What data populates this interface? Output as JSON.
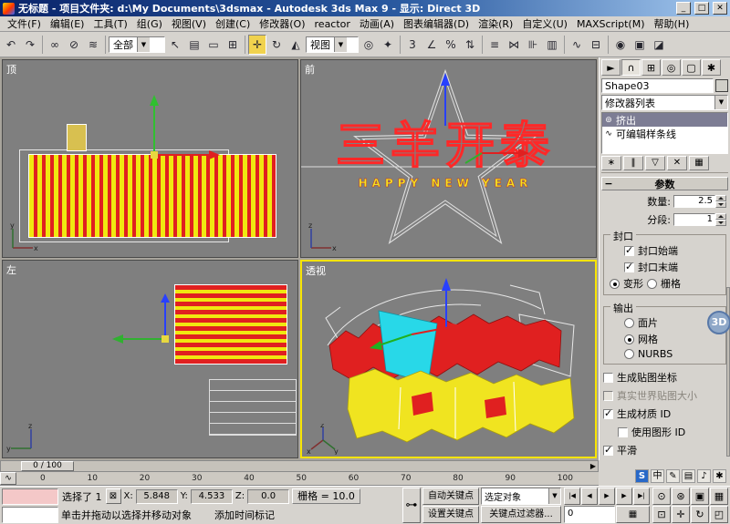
{
  "titlebar": {
    "title": "无标题 - 项目文件夹: d:\\My Documents\\3dsmax  -  Autodesk 3ds Max 9  -  显示: Direct 3D"
  },
  "menu": {
    "items": [
      "文件(F)",
      "编辑(E)",
      "工具(T)",
      "组(G)",
      "视图(V)",
      "创建(C)",
      "修改器(O)",
      "reactor",
      "动画(A)",
      "图表编辑器(D)",
      "渲染(R)",
      "自定义(U)",
      "MAXScript(M)",
      "帮助(H)"
    ]
  },
  "toolbar": {
    "selection_filter": "全部",
    "coord_system": "视图"
  },
  "viewports": {
    "top": {
      "label": "顶"
    },
    "front": {
      "label": "前",
      "banner": "三羊开泰",
      "subbanner": "HAPPY NEW YEAR"
    },
    "left": {
      "label": "左"
    },
    "persp": {
      "label": "透视"
    }
  },
  "panel": {
    "object_name": "Shape03",
    "modifier_list": "修改器列表",
    "stack": [
      {
        "label": "挤出"
      },
      {
        "label": "可编辑样条线"
      }
    ],
    "rollout_title": "参数",
    "amount_label": "数量:",
    "amount_value": "2.5",
    "segments_label": "分段:",
    "segments_value": "1",
    "cap_group": "封口",
    "cap_start": "封口始端",
    "cap_end": "封口末端",
    "morph": "变形",
    "grid": "栅格",
    "output_group": "输出",
    "patch": "面片",
    "mesh": "网格",
    "nurbs": "NURBS",
    "gen_mapping": "生成贴图坐标",
    "real_world": "真实世界贴图大小",
    "gen_matid": "生成材质 ID",
    "use_shapeid": "使用图形 ID",
    "smooth": "平滑",
    "badge_3d": "3D"
  },
  "time": {
    "slider_label": "0 / 100",
    "ticks": [
      "0",
      "10",
      "20",
      "30",
      "40",
      "50",
      "60",
      "70",
      "80",
      "90",
      "100"
    ]
  },
  "status": {
    "selection_count": "选择了 1",
    "x_label": "X:",
    "x_value": "5.848",
    "y_label": "Y:",
    "y_value": "4.533",
    "z_label": "Z:",
    "z_value": "0.0",
    "grid_readout": "栅格 = 10.0",
    "prompt": "单击并拖动以选择并移动对象",
    "add_time_tag": "添加时间标记",
    "auto_key": "自动关键点",
    "set_key": "设置关键点",
    "selected_objects": "选定对象",
    "key_filters": "关键点过滤器...",
    "frame_value": "0"
  },
  "icons": {
    "min": "_",
    "max": "□",
    "close": "✕",
    "undo": "↶",
    "redo": "↷",
    "select_link": "∞",
    "unlink": "⊘",
    "bind_spacewarp": "≋",
    "select_object": "↖",
    "select_by_name": "▤",
    "rect_region": "▭",
    "crossing": "⊞",
    "move": "✛",
    "rotate": "↻",
    "scale": "◭",
    "pivot": "◎",
    "manipulate": "✦",
    "snap_3d": "3",
    "snap_angle": "∠",
    "snap_percent": "%",
    "snap_spinner": "⇅",
    "named_sets": "≡",
    "mirror": "⋈",
    "align": "⊪",
    "layers": "▥",
    "curve_editor": "∿",
    "schematic": "⊟",
    "material": "◉",
    "render_setup": "▣",
    "quick_render": "◪",
    "tab_create": "►",
    "tab_modify": "∩",
    "tab_hierarchy": "⊞",
    "tab_motion": "◎",
    "tab_display": "▢",
    "tab_utilities": "✱",
    "stack_mod": "⊚",
    "stack_base": "∿",
    "pin": "∗",
    "show_end": "‖",
    "unique": "▽",
    "remove": "✕",
    "config": "▦",
    "lock": "⊠",
    "key": "⊶",
    "dropdown": "▼",
    "minus": "−",
    "play_start": "|◀",
    "play_prev": "◀",
    "play": "▶",
    "play_next": "▶",
    "play_end": "▶|",
    "time_config": "▦",
    "nav_zoom": "⊙",
    "nav_zoom_all": "⊛",
    "nav_extents": "▣",
    "nav_extents_all": "▦",
    "nav_region": "⊡",
    "nav_pan": "✛",
    "nav_orbit": "↻",
    "nav_max": "◰",
    "mini_curve": "∿",
    "sogou": "S",
    "lang": "中",
    "pen": "✎",
    "kbd": "▤",
    "spk": "♪",
    "opts": "✱"
  }
}
